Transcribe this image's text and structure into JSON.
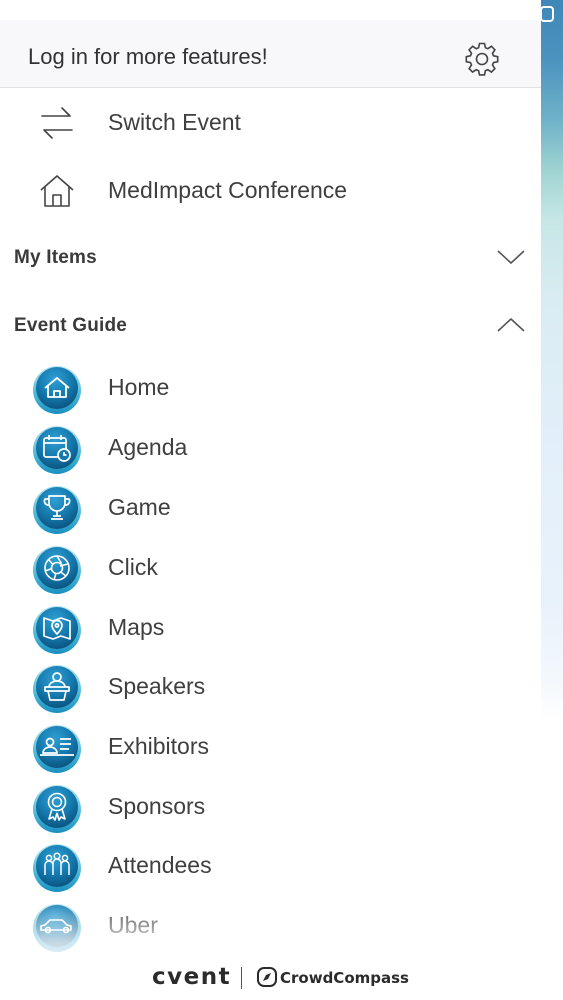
{
  "header": {
    "login_prompt": "Log in for more features!",
    "settings_icon": "gear-icon"
  },
  "top_items": [
    {
      "label": "Switch Event",
      "icon": "switch-arrows-icon"
    },
    {
      "label": "MedImpact Conference",
      "icon": "home-outline-icon"
    }
  ],
  "sections": {
    "my_items": {
      "label": "My Items",
      "state": "collapsed",
      "icon": "chevron-down-icon"
    },
    "event_guide": {
      "label": "Event Guide",
      "state": "expanded",
      "icon": "chevron-up-icon"
    }
  },
  "event_guide_items": [
    {
      "label": "Home",
      "icon": "house-icon"
    },
    {
      "label": "Agenda",
      "icon": "calendar-clock-icon"
    },
    {
      "label": "Game",
      "icon": "trophy-icon"
    },
    {
      "label": "Click",
      "icon": "camera-shutter-icon"
    },
    {
      "label": "Maps",
      "icon": "map-pin-icon"
    },
    {
      "label": "Speakers",
      "icon": "podium-speaker-icon"
    },
    {
      "label": "Exhibitors",
      "icon": "id-card-icon"
    },
    {
      "label": "Sponsors",
      "icon": "award-ribbon-icon"
    },
    {
      "label": "Attendees",
      "icon": "people-group-icon"
    },
    {
      "label": "Uber",
      "icon": "car-icon"
    }
  ],
  "footer": {
    "brand_left": "cvent",
    "brand_right": "CrowdCompass"
  },
  "colors": {
    "icon_dark": "#0b5a87",
    "icon_mid": "#1f86bd",
    "icon_light": "#7fd0e6",
    "label_text": "#3f3f3f",
    "header_bg": "#f8f7fa"
  }
}
